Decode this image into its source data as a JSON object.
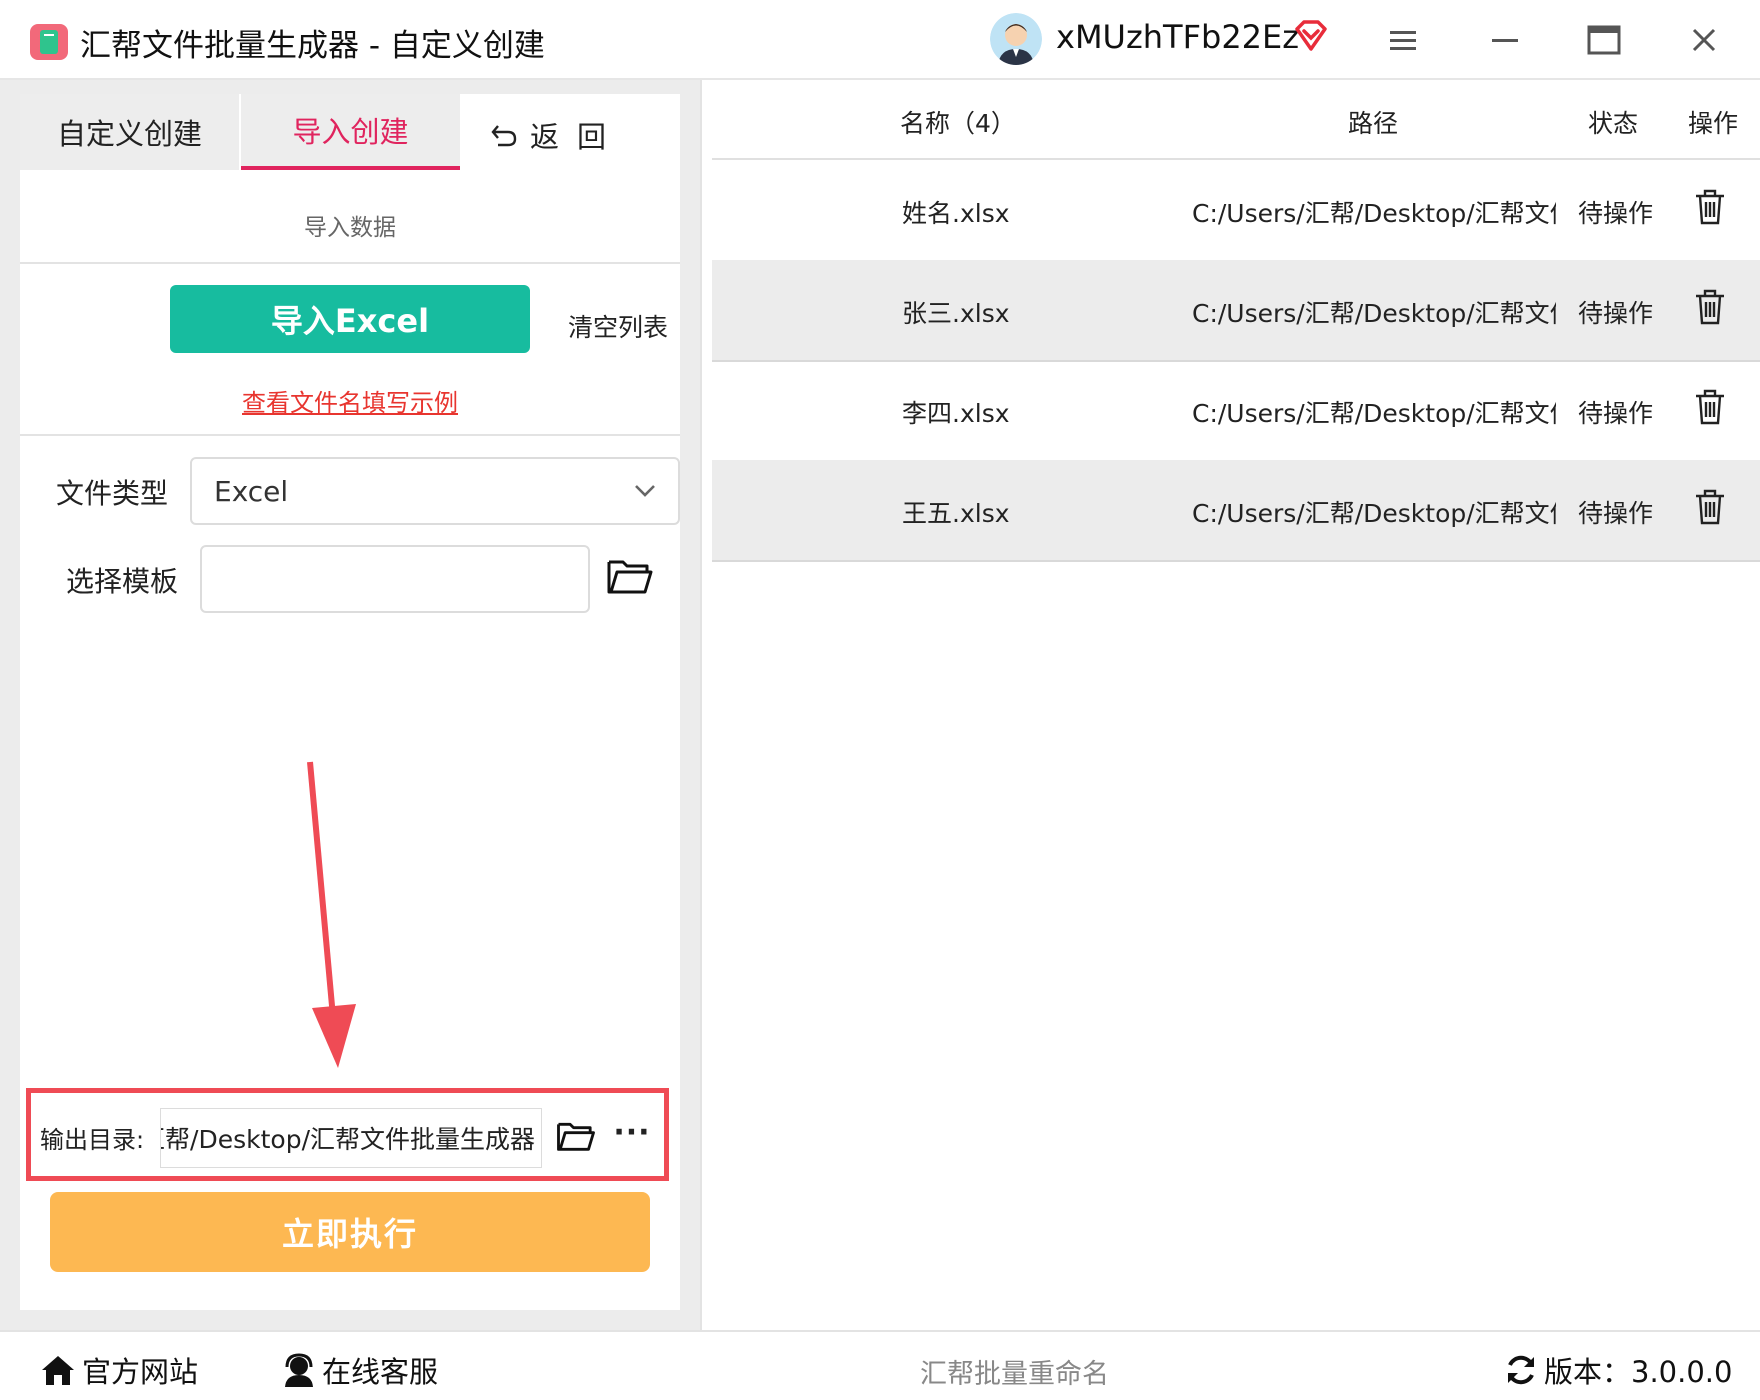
{
  "window": {
    "title": "汇帮文件批量生成器 - 自定义创建",
    "username": "xMUzhTFb22Ez"
  },
  "tabs": {
    "custom_label": "自定义创建",
    "import_label": "导入创建",
    "back_label": "返回"
  },
  "import_section": {
    "title": "导入数据",
    "import_button": "导入Excel",
    "clear_button": "清空列表",
    "example_link": "查看文件名填写示例"
  },
  "form": {
    "filetype_label": "文件类型",
    "filetype_value": "Excel",
    "template_label": "选择模板",
    "template_value": ""
  },
  "output": {
    "label": "输出目录:",
    "path": "C:/Users/汇帮/Desktop/汇帮文件批量生成器",
    "more": "···"
  },
  "execute_button": "立即执行",
  "table": {
    "headers": {
      "name": "名称（4）",
      "path": "路径",
      "status": "状态",
      "op": "操作"
    },
    "rows": [
      {
        "name": "姓名.xlsx",
        "path": "C:/Users/汇帮/Desktop/汇帮文件",
        "status": "待操作"
      },
      {
        "name": "张三.xlsx",
        "path": "C:/Users/汇帮/Desktop/汇帮文件",
        "status": "待操作"
      },
      {
        "name": "李四.xlsx",
        "path": "C:/Users/汇帮/Desktop/汇帮文件",
        "status": "待操作"
      },
      {
        "name": "王五.xlsx",
        "path": "C:/Users/汇帮/Desktop/汇帮文件",
        "status": "待操作"
      }
    ]
  },
  "statusbar": {
    "site_link": "官方网站",
    "support_link": "在线客服",
    "center_text": "汇帮批量重命名",
    "version": "版本：3.0.0.0"
  },
  "colors": {
    "accent_pink": "#e0245e",
    "import_green": "#17bc9f",
    "execute_orange": "#fdb852",
    "highlight_red": "#ef4b55"
  },
  "icons": {
    "app": "app-logo-icon",
    "vip": "vip-diamond-icon",
    "menu": "menu-icon",
    "minimize": "minimize-icon",
    "maximize": "maximize-icon",
    "close": "close-icon",
    "back": "back-arrow-icon",
    "folder": "folder-icon",
    "delete": "trash-icon",
    "home": "home-icon",
    "support": "support-agent-icon",
    "refresh": "refresh-icon"
  }
}
